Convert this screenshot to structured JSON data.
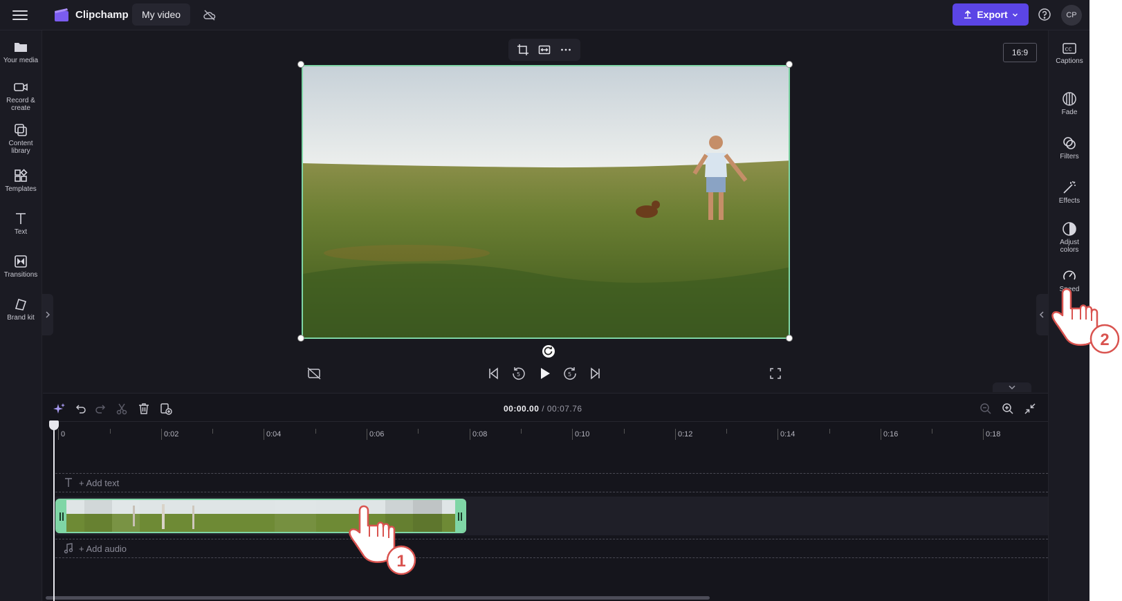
{
  "app": {
    "name": "Clipchamp",
    "project_title": "My video",
    "avatar_initials": "CP",
    "export_label": "Export",
    "accent_color": "#5b45e6",
    "selection_color": "#7fd6a6"
  },
  "left_nav": [
    {
      "label": "Your media",
      "icon": "folder-icon"
    },
    {
      "label": "Record &\ncreate",
      "icon": "camera-icon"
    },
    {
      "label": "Content\nlibrary",
      "icon": "library-icon"
    },
    {
      "label": "Templates",
      "icon": "templates-icon"
    },
    {
      "label": "Text",
      "icon": "text-icon"
    },
    {
      "label": "Transitions",
      "icon": "transitions-icon"
    },
    {
      "label": "Brand kit",
      "icon": "brand-kit-icon"
    }
  ],
  "right_nav": [
    {
      "label": "Captions",
      "icon": "captions-icon"
    },
    {
      "label": "Fade",
      "icon": "fade-icon"
    },
    {
      "label": "Filters",
      "icon": "filters-icon"
    },
    {
      "label": "Effects",
      "icon": "effects-icon"
    },
    {
      "label": "Adjust\ncolors",
      "icon": "adjust-colors-icon"
    },
    {
      "label": "Speed",
      "icon": "speed-icon"
    }
  ],
  "preview": {
    "aspect_ratio": "16:9"
  },
  "timeline": {
    "current_time": "00:00.00",
    "total_time": "/ 00:07.76",
    "ruler_ticks": [
      "0",
      "0:02",
      "0:04",
      "0:06",
      "0:08",
      "0:10",
      "0:12",
      "0:14",
      "0:16",
      "0:18"
    ],
    "add_text_label": "+ Add text",
    "add_audio_label": "+ Add audio"
  },
  "annotations": {
    "step1": "1",
    "step2": "2"
  }
}
